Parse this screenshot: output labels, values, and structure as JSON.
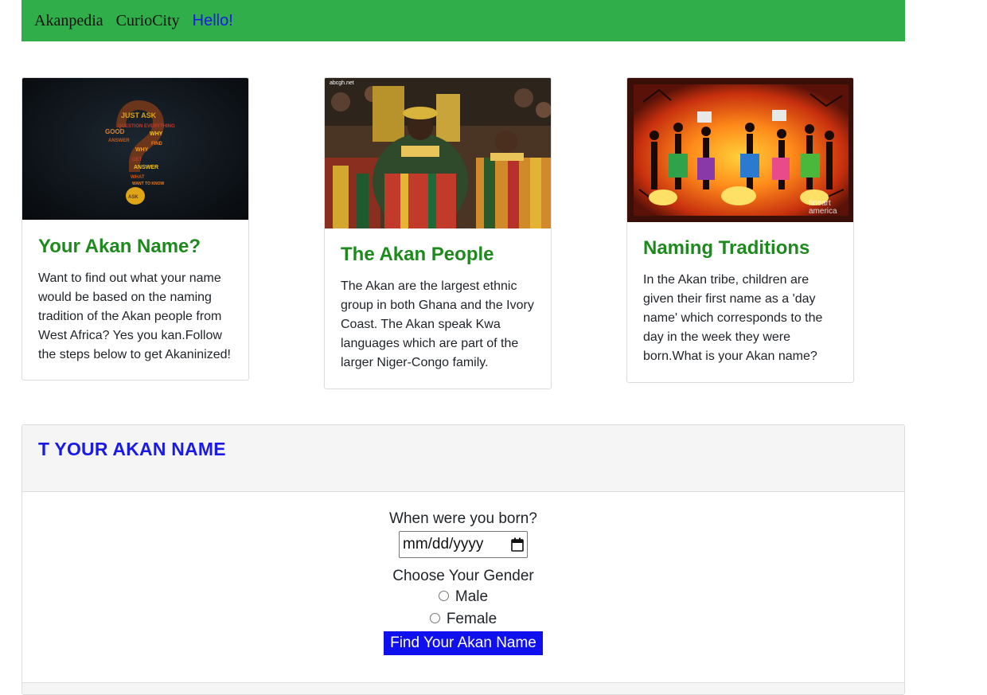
{
  "nav": {
    "brand": "Akanpedia",
    "link1": "CurioCity",
    "link2": "Hello!"
  },
  "cards": [
    {
      "title": "Your Akan Name?",
      "text": "Want to find out what your name would be based on the naming tradition of the Akan people from West Africa? Yes you kan.Follow the steps below to get Akaninized!",
      "image_icon": "question-mark-word-cloud"
    },
    {
      "title": "The Akan People",
      "text": "The Akan are the largest ethnic group in both Ghana and the Ivory Coast. The Akan speak Kwa languages which are part of the larger Niger-Congo family.",
      "image_icon": "akan-chiefs-photo",
      "image_watermark": "abcgh.net"
    },
    {
      "title": "Naming Traditions",
      "text": "In the Akan tribe, children are given their first name as a 'day name' which corresponds to the day in the week they were born.What is your Akan name?",
      "image_icon": "african-dancers-painting",
      "image_watermark_1": "fineart",
      "image_watermark_2": "america"
    }
  ],
  "form": {
    "heading": "T YOUR AKAN NAME",
    "date_label": "When were you born?",
    "date_placeholder": "mm/dd/yyyy",
    "gender_label": "Choose Your Gender",
    "options": [
      "Male",
      "Female"
    ],
    "submit_label": "Find Your Akan Name"
  },
  "colors": {
    "navbar": "#2fae49",
    "card_title": "#1e8a1e",
    "heading": "#1a1ae6",
    "button": "#1010ee"
  }
}
